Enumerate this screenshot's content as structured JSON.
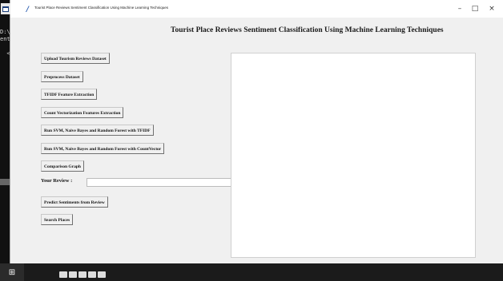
{
  "console": {
    "lines": "D:\\\nent>\n\n  <"
  },
  "window": {
    "title": "Tourist Place Reviews Sentiment Classification Using Machine Learning Techniques",
    "minimize": "–",
    "restore": "□",
    "close": "×"
  },
  "main": {
    "heading": "Tourist Place Reviews Sentiment Classification Using Machine Learning Techniques",
    "buttons": {
      "upload": "Upload Tourism Reviews Dataset",
      "preprocess": "Preprocess Dataset",
      "tfidf": "TFIDF Feature Extraction",
      "count_vec": "Count Vectorization Features Extraction",
      "run_tfidf": "Run SVM, Naive Bayes and Random Forest with TFIDF",
      "run_count": "Run SVM, Naive Bayes and Random Forest with CountVector",
      "comparison": "Comparison Graph",
      "predict": "Predict Sentiments from Review",
      "search": "Search Places"
    },
    "review_label": "Your Review :",
    "review_value": "",
    "output_text": ""
  },
  "taskbar": {
    "start_glyph": "⊞"
  },
  "colors": {
    "background": "#f0f0f0",
    "output_bg": "#ffffff",
    "taskbar": "#1b1b1b"
  }
}
